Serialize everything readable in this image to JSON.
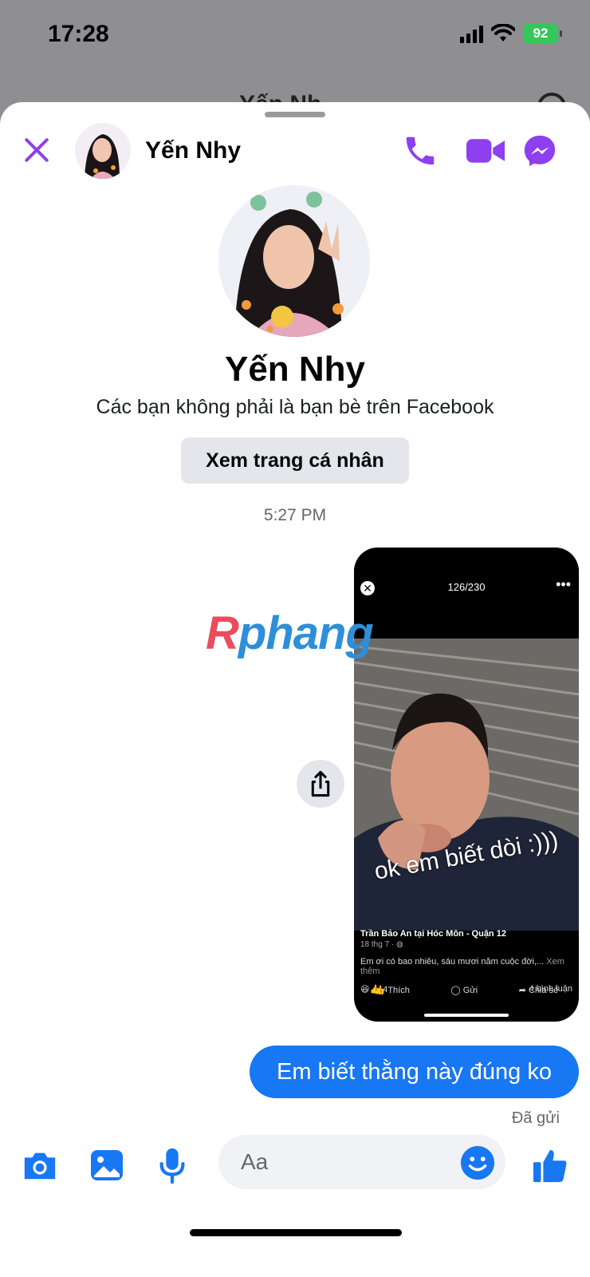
{
  "status_bar": {
    "time": "17:28",
    "battery": "92"
  },
  "background_header": {
    "title": "Yến Nh"
  },
  "header": {
    "contact_name": "Yến Nhy"
  },
  "profile": {
    "name": "Yến Nhy",
    "friend_note": "Các bạn không phải là bạn bè trên Facebook",
    "view_profile_label": "Xem trang cá nhân"
  },
  "conversation": {
    "timestamp": "5:27 PM",
    "shared_post": {
      "counter": "126/230",
      "caption": "ok em biết dòi :)))",
      "author": "Trần Bảo An tại Hóc Môn - Quận 12",
      "date": "18 thg 7 · ",
      "text": "Em ơi có bao nhiêu, sáu mươi năm cuộc đời,...",
      "more": "Xem thêm",
      "reactions_count": "4",
      "comments": "4 bình luận",
      "actions": {
        "like": "Thích",
        "send": "Gửi",
        "share": "Chia sẻ"
      }
    },
    "message": "Em biết thằng này đúng ko",
    "sent_status": "Đã gửi"
  },
  "watermark": {
    "first": "R",
    "rest": "phang"
  },
  "composer": {
    "placeholder": "Aa"
  },
  "colors": {
    "accent_purple": "#8e3ff0",
    "messenger_blue": "#1877f2"
  }
}
